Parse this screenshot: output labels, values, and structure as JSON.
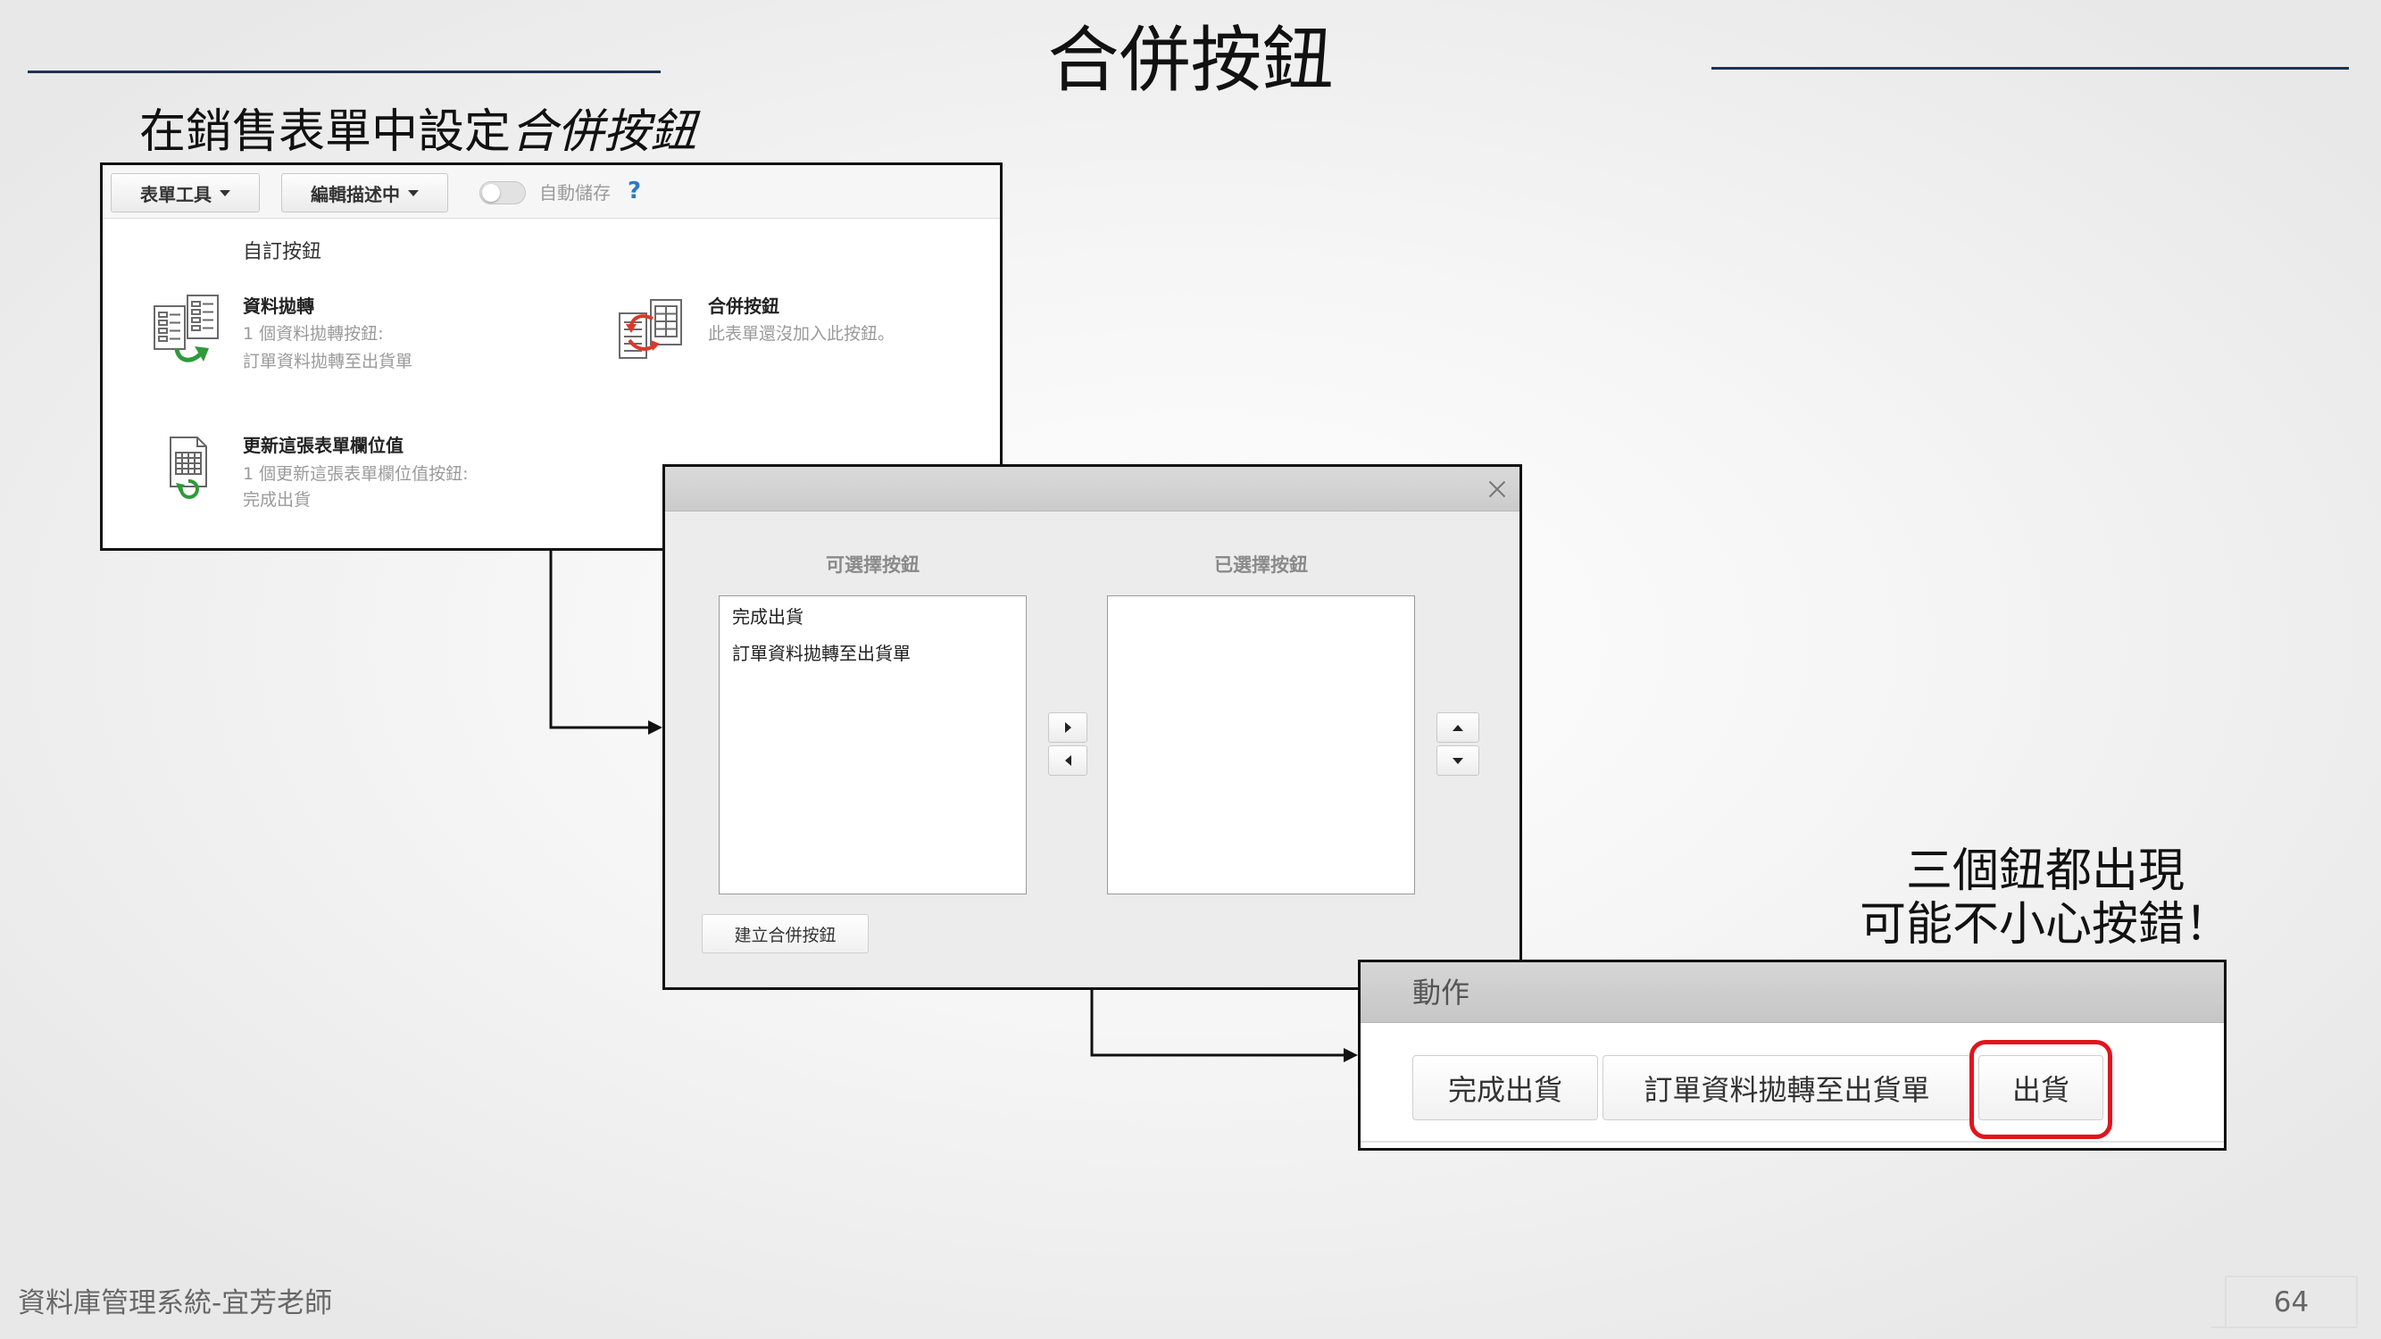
{
  "slide": {
    "title": "合併按鈕",
    "subtitle": "在銷售表單中設定",
    "subtitle_emphasis": "合併按鈕",
    "annotation": [
      "三個鈕都出現",
      "可能不小心按錯！"
    ],
    "footer": "資料庫管理系統-宜芳老師",
    "page_number": "64"
  },
  "colors": {
    "title_rule": "#1f3350",
    "highlight_ring": "#e0141e",
    "help_icon": "#2a7ac8"
  },
  "form_panel": {
    "toolbar": {
      "form_tools": "表單工具",
      "edit_description": "編輯描述中",
      "autosave": "自動儲存",
      "autosave_enabled": false,
      "help": "?"
    },
    "section_title": "自訂按鈕",
    "button_types": [
      {
        "icon": "data-transfer-icon",
        "title": "資料拋轉",
        "lines": [
          "1 個資料拋轉按鈕:",
          "訂單資料拋轉至出貨單"
        ]
      },
      {
        "icon": "merge-button-icon",
        "title": "合併按鈕",
        "lines": [
          "此表單還沒加入此按鈕。"
        ]
      },
      {
        "icon": "update-field-icon",
        "title": "更新這張表單欄位值",
        "lines": [
          "1 個更新這張表單欄位值按鈕:",
          "完成出貨"
        ]
      }
    ]
  },
  "merge_dialog": {
    "close_icon": "close-icon",
    "available_title": "可選擇按鈕",
    "selected_title": "已選擇按鈕",
    "available_items": [
      "完成出貨",
      "訂單資料拋轉至出貨單"
    ],
    "selected_items": [],
    "move_icons": [
      "caret-right-icon",
      "caret-left-icon",
      "caret-up-icon",
      "caret-down-icon"
    ],
    "create_button": "建立合併按鈕"
  },
  "action_panel": {
    "title": "動作",
    "buttons": [
      "完成出貨",
      "訂單資料拋轉至出貨單",
      "出貨"
    ]
  }
}
